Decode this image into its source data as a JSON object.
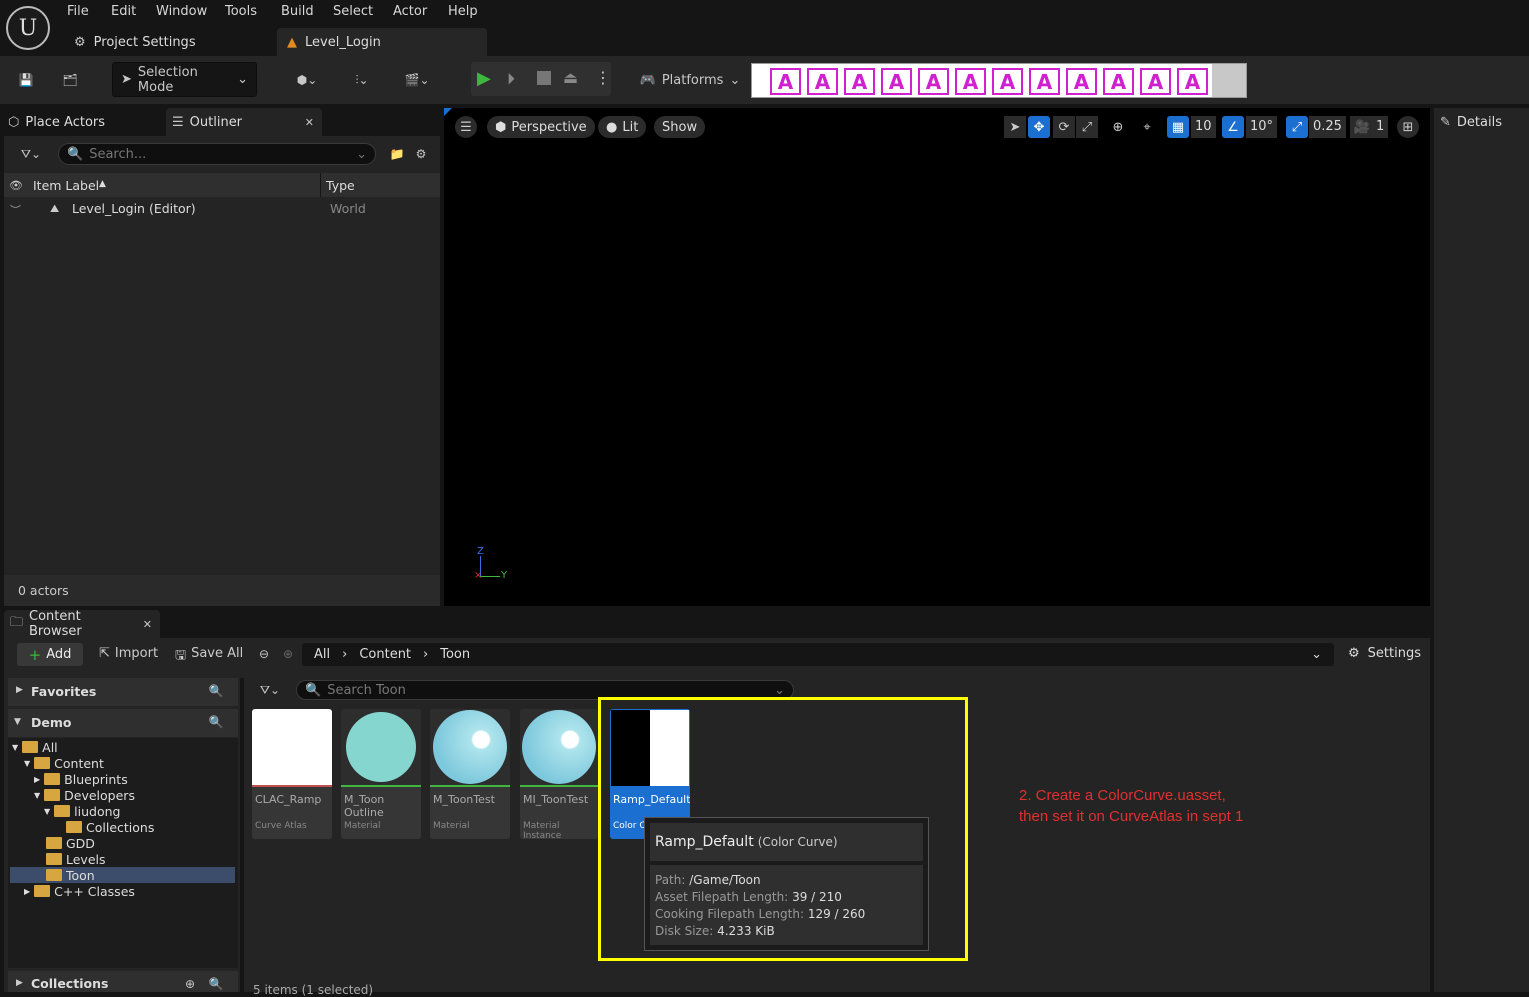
{
  "menu": [
    "File",
    "Edit",
    "Window",
    "Tools",
    "Build",
    "Select",
    "Actor",
    "Help"
  ],
  "tabs": {
    "project_settings": "Project Settings",
    "level": "Level_Login"
  },
  "toolbar": {
    "selection_mode": "Selection Mode",
    "platforms": "Platforms"
  },
  "banner_glyph": "A",
  "outliner": {
    "place_actors": "Place Actors",
    "title": "Outliner",
    "search_placeholder": "Search...",
    "col_label": "Item Label",
    "col_type": "Type",
    "rows": [
      {
        "label": "Level_Login (Editor)",
        "type": "World"
      }
    ],
    "footer": "0 actors"
  },
  "viewport": {
    "perspective": "Perspective",
    "lit": "Lit",
    "show": "Show",
    "grid": "10",
    "angle": "10°",
    "scale": "0.25",
    "camera": "1",
    "axis_z": "Z",
    "axis_y": "Y"
  },
  "details": {
    "title": "Details"
  },
  "content_browser": {
    "title": "Content Browser",
    "add": "Add",
    "import": "Import",
    "save_all": "Save All",
    "breadcrumb": [
      "All",
      "Content",
      "Toon"
    ],
    "settings": "Settings",
    "search_placeholder": "Search Toon",
    "favorites": "Favorites",
    "demo": "Demo",
    "collections": "Collections",
    "status": "5 items (1 selected)",
    "tree": [
      {
        "label": "All",
        "depth": 0
      },
      {
        "label": "Content",
        "depth": 1
      },
      {
        "label": "Blueprints",
        "depth": 2
      },
      {
        "label": "Developers",
        "depth": 2
      },
      {
        "label": "liudong",
        "depth": 3
      },
      {
        "label": "Collections",
        "depth": 4
      },
      {
        "label": "GDD",
        "depth": 2
      },
      {
        "label": "Levels",
        "depth": 2
      },
      {
        "label": "Toon",
        "depth": 2
      },
      {
        "label": "C++ Classes",
        "depth": 1
      }
    ],
    "assets": [
      {
        "name": "CLAC_Ramp",
        "type": "Curve Atlas"
      },
      {
        "name": "M_Toon Outline",
        "type": "Material"
      },
      {
        "name": "M_ToonTest",
        "type": "Material"
      },
      {
        "name": "MI_ToonTest",
        "type": "Material Instance"
      },
      {
        "name": "Ramp_Default",
        "type": "Color C"
      }
    ]
  },
  "tooltip": {
    "title": "Ramp_Default",
    "kind": "(Color Curve)",
    "path_label": "Path:",
    "path": "/Game/Toon",
    "asset_len_label": "Asset Filepath Length:",
    "asset_len": "39 / 210",
    "cook_len_label": "Cooking Filepath Length:",
    "cook_len": "129 / 260",
    "disk_label": "Disk Size:",
    "disk": "4.233 KiB"
  },
  "annotation": {
    "line1": "2. Create a ColorCurve.uasset,",
    "line2": "then set it on CurveAtlas in sept 1"
  },
  "colors": {
    "accent": "#1a6fd0",
    "highlight": "#ffff00",
    "annotation": "#e03030",
    "banner_pink": "#d020d0"
  }
}
